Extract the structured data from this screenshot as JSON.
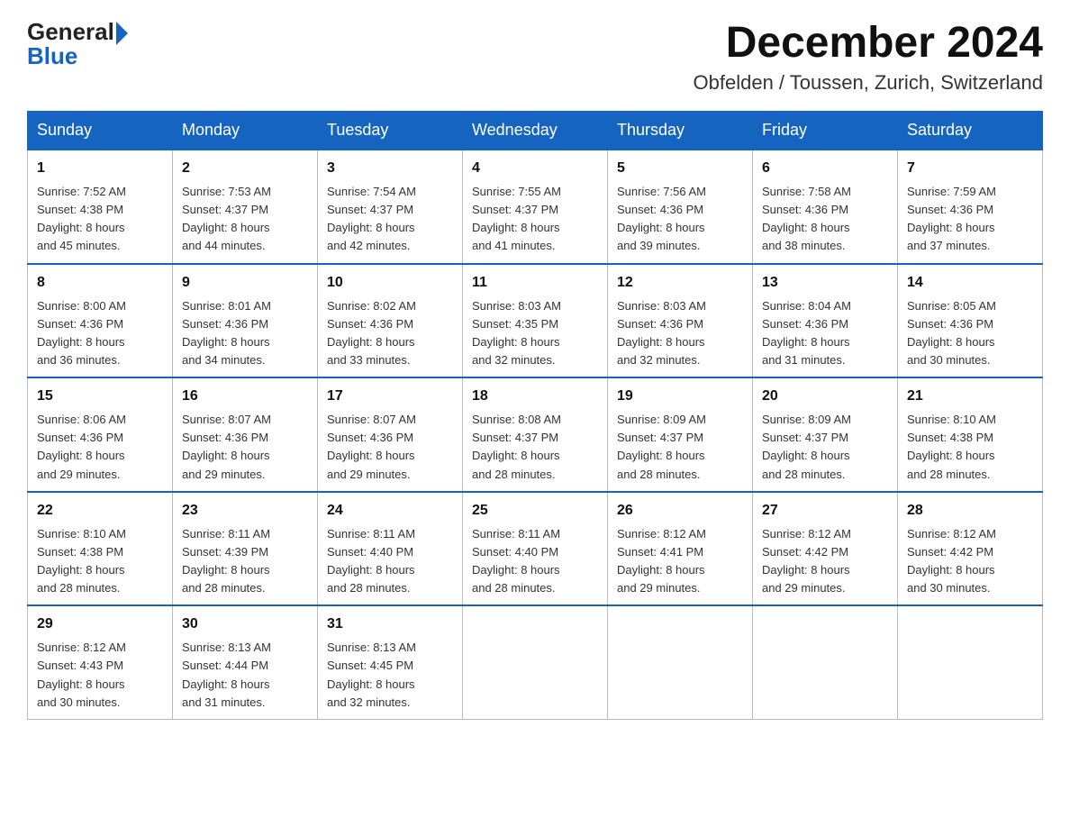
{
  "logo": {
    "top": "General",
    "bottom": "Blue"
  },
  "title": {
    "month_year": "December 2024",
    "location": "Obfelden / Toussen, Zurich, Switzerland"
  },
  "days_of_week": [
    "Sunday",
    "Monday",
    "Tuesday",
    "Wednesday",
    "Thursday",
    "Friday",
    "Saturday"
  ],
  "weeks": [
    [
      {
        "day": "1",
        "sunrise": "7:52 AM",
        "sunset": "4:38 PM",
        "daylight": "8 hours and 45 minutes."
      },
      {
        "day": "2",
        "sunrise": "7:53 AM",
        "sunset": "4:37 PM",
        "daylight": "8 hours and 44 minutes."
      },
      {
        "day": "3",
        "sunrise": "7:54 AM",
        "sunset": "4:37 PM",
        "daylight": "8 hours and 42 minutes."
      },
      {
        "day": "4",
        "sunrise": "7:55 AM",
        "sunset": "4:37 PM",
        "daylight": "8 hours and 41 minutes."
      },
      {
        "day": "5",
        "sunrise": "7:56 AM",
        "sunset": "4:36 PM",
        "daylight": "8 hours and 39 minutes."
      },
      {
        "day": "6",
        "sunrise": "7:58 AM",
        "sunset": "4:36 PM",
        "daylight": "8 hours and 38 minutes."
      },
      {
        "day": "7",
        "sunrise": "7:59 AM",
        "sunset": "4:36 PM",
        "daylight": "8 hours and 37 minutes."
      }
    ],
    [
      {
        "day": "8",
        "sunrise": "8:00 AM",
        "sunset": "4:36 PM",
        "daylight": "8 hours and 36 minutes."
      },
      {
        "day": "9",
        "sunrise": "8:01 AM",
        "sunset": "4:36 PM",
        "daylight": "8 hours and 34 minutes."
      },
      {
        "day": "10",
        "sunrise": "8:02 AM",
        "sunset": "4:36 PM",
        "daylight": "8 hours and 33 minutes."
      },
      {
        "day": "11",
        "sunrise": "8:03 AM",
        "sunset": "4:35 PM",
        "daylight": "8 hours and 32 minutes."
      },
      {
        "day": "12",
        "sunrise": "8:03 AM",
        "sunset": "4:36 PM",
        "daylight": "8 hours and 32 minutes."
      },
      {
        "day": "13",
        "sunrise": "8:04 AM",
        "sunset": "4:36 PM",
        "daylight": "8 hours and 31 minutes."
      },
      {
        "day": "14",
        "sunrise": "8:05 AM",
        "sunset": "4:36 PM",
        "daylight": "8 hours and 30 minutes."
      }
    ],
    [
      {
        "day": "15",
        "sunrise": "8:06 AM",
        "sunset": "4:36 PM",
        "daylight": "8 hours and 29 minutes."
      },
      {
        "day": "16",
        "sunrise": "8:07 AM",
        "sunset": "4:36 PM",
        "daylight": "8 hours and 29 minutes."
      },
      {
        "day": "17",
        "sunrise": "8:07 AM",
        "sunset": "4:36 PM",
        "daylight": "8 hours and 29 minutes."
      },
      {
        "day": "18",
        "sunrise": "8:08 AM",
        "sunset": "4:37 PM",
        "daylight": "8 hours and 28 minutes."
      },
      {
        "day": "19",
        "sunrise": "8:09 AM",
        "sunset": "4:37 PM",
        "daylight": "8 hours and 28 minutes."
      },
      {
        "day": "20",
        "sunrise": "8:09 AM",
        "sunset": "4:37 PM",
        "daylight": "8 hours and 28 minutes."
      },
      {
        "day": "21",
        "sunrise": "8:10 AM",
        "sunset": "4:38 PM",
        "daylight": "8 hours and 28 minutes."
      }
    ],
    [
      {
        "day": "22",
        "sunrise": "8:10 AM",
        "sunset": "4:38 PM",
        "daylight": "8 hours and 28 minutes."
      },
      {
        "day": "23",
        "sunrise": "8:11 AM",
        "sunset": "4:39 PM",
        "daylight": "8 hours and 28 minutes."
      },
      {
        "day": "24",
        "sunrise": "8:11 AM",
        "sunset": "4:40 PM",
        "daylight": "8 hours and 28 minutes."
      },
      {
        "day": "25",
        "sunrise": "8:11 AM",
        "sunset": "4:40 PM",
        "daylight": "8 hours and 28 minutes."
      },
      {
        "day": "26",
        "sunrise": "8:12 AM",
        "sunset": "4:41 PM",
        "daylight": "8 hours and 29 minutes."
      },
      {
        "day": "27",
        "sunrise": "8:12 AM",
        "sunset": "4:42 PM",
        "daylight": "8 hours and 29 minutes."
      },
      {
        "day": "28",
        "sunrise": "8:12 AM",
        "sunset": "4:42 PM",
        "daylight": "8 hours and 30 minutes."
      }
    ],
    [
      {
        "day": "29",
        "sunrise": "8:12 AM",
        "sunset": "4:43 PM",
        "daylight": "8 hours and 30 minutes."
      },
      {
        "day": "30",
        "sunrise": "8:13 AM",
        "sunset": "4:44 PM",
        "daylight": "8 hours and 31 minutes."
      },
      {
        "day": "31",
        "sunrise": "8:13 AM",
        "sunset": "4:45 PM",
        "daylight": "8 hours and 32 minutes."
      },
      null,
      null,
      null,
      null
    ]
  ],
  "labels": {
    "sunrise": "Sunrise:",
    "sunset": "Sunset:",
    "daylight": "Daylight:"
  }
}
